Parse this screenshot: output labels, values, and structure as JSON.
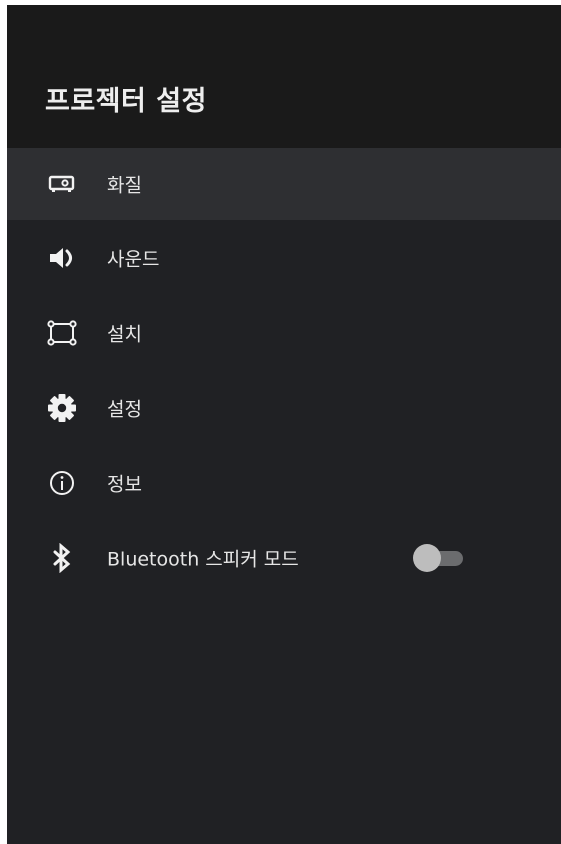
{
  "header": {
    "title": "프로젝터 설정"
  },
  "menu": {
    "items": [
      {
        "label": "화질",
        "icon": "projector-icon",
        "selected": true
      },
      {
        "label": "사운드",
        "icon": "speaker-icon"
      },
      {
        "label": "설치",
        "icon": "install-frame-icon"
      },
      {
        "label": "설정",
        "icon": "gear-icon"
      },
      {
        "label": "정보",
        "icon": "info-icon"
      },
      {
        "label": "Bluetooth 스피커 모드",
        "icon": "bluetooth-icon",
        "toggle": false
      }
    ]
  },
  "colors": {
    "background": "#202124",
    "header_background": "#1a1a1a",
    "selected_row": "#2e2f32",
    "text": "#e6e6e6",
    "toggle_thumb": "#bdbdbd",
    "toggle_track": "#6b6c6e"
  }
}
